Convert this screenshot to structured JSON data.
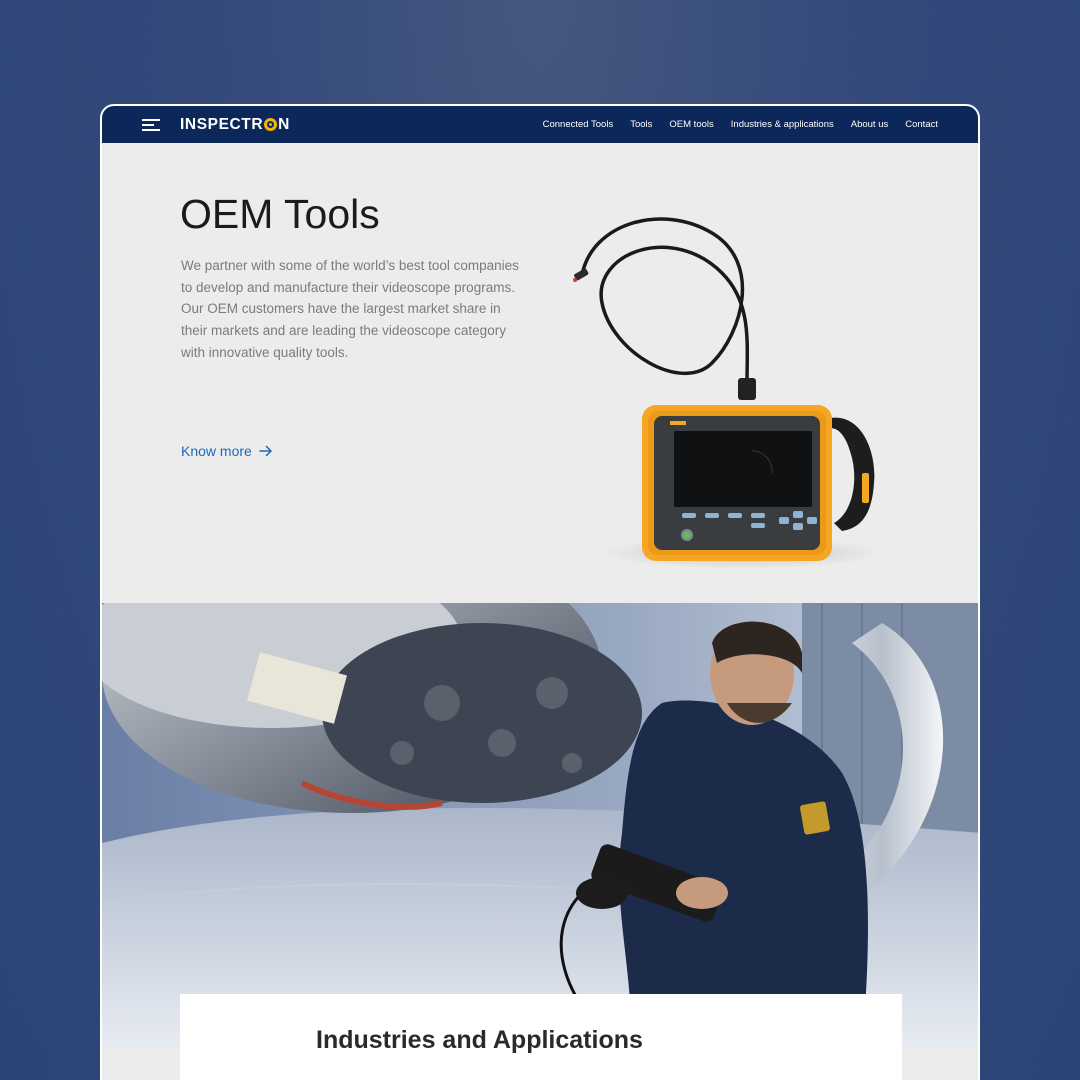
{
  "brand": {
    "name_prefix": "INSPECTR",
    "name_suffix": "N"
  },
  "nav": {
    "items": [
      {
        "label": "Connected Tools"
      },
      {
        "label": "Tools"
      },
      {
        "label": "OEM tools"
      },
      {
        "label": "Industries & applications"
      },
      {
        "label": "About us"
      },
      {
        "label": "Contact"
      }
    ]
  },
  "hero": {
    "title": "OEM Tools",
    "body": "We partner with some of the world’s best tool companies to develop and manufacture their videoscope programs. Our OEM customers have the largest market share in their markets and are leading the videoscope category with innovative quality tools.",
    "cta_label": "Know more"
  },
  "section": {
    "title": "Industries and Applications"
  },
  "colors": {
    "navbar": "#0c2759",
    "accent_link": "#1e6ab7",
    "logo_accent": "#f5b400",
    "device_housing": "#f5a623",
    "page_background": "#2c4478"
  },
  "icons": {
    "menu": "hamburger-icon",
    "cta_arrow": "arrow-right-icon"
  }
}
